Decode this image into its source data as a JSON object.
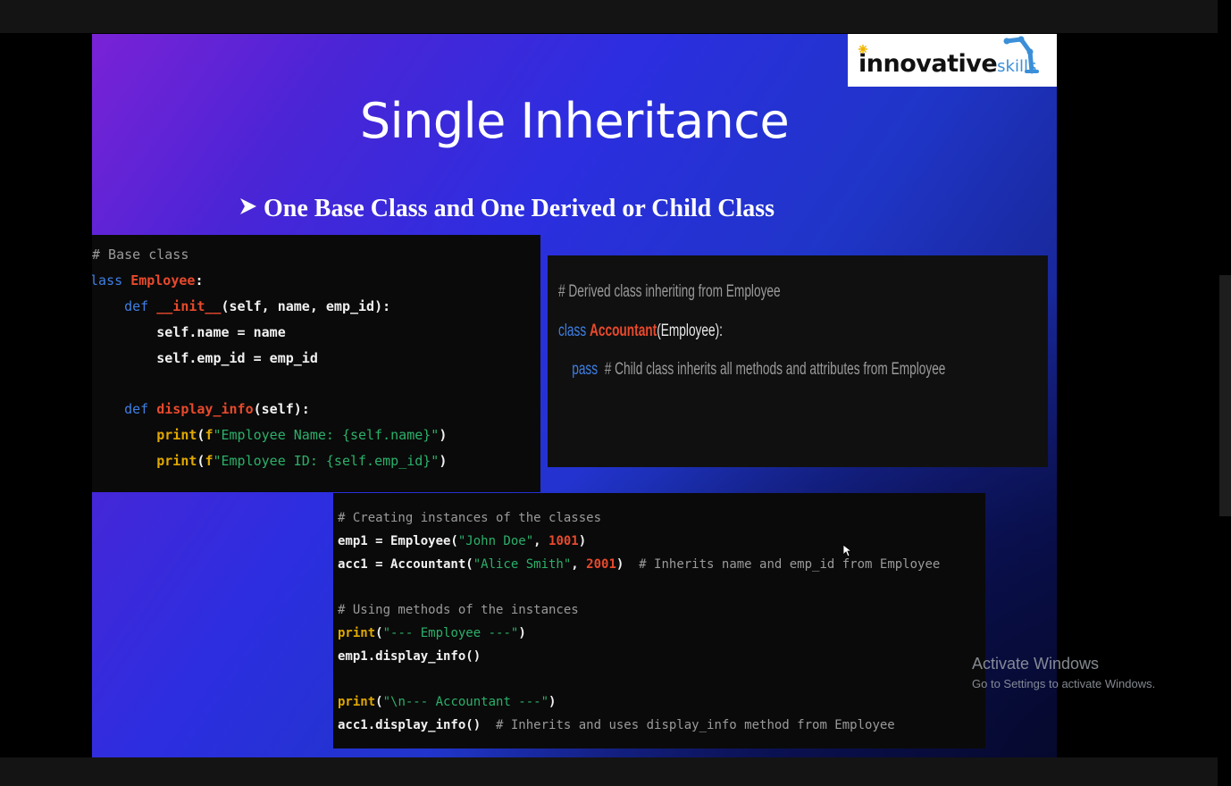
{
  "logo": {
    "brand": "innovative",
    "suffix": "skills"
  },
  "slide": {
    "title": "Single Inheritance",
    "bullet_icon": "arrow-bullet-icon",
    "subtitle": "One Base  Class and One Derived or Child Class"
  },
  "code": {
    "base": [
      "# Base class",
      "class Employee:",
      "    def __init__(self, name, emp_id):",
      "        self.name = name",
      "        self.emp_id = emp_id",
      "    def display_info(self):",
      "        print(f\"Employee Name: {self.name}\")",
      "        print(f\"Employee ID: {self.emp_id}\")"
    ],
    "derived": [
      "# Derived class inheriting from Employee",
      "class Accountant(Employee):",
      "    pass  # Child class inherits all methods and attributes from Employee"
    ],
    "usage": [
      "# Creating instances of the classes",
      "emp1 = Employee(\"John Doe\", 1001)",
      "acc1 = Accountant(\"Alice Smith\", 2001)  # Inherits name and emp_id from Employee",
      "# Using methods of the instances",
      "print(\"--- Employee ---\")",
      "emp1.display_info()",
      "print(\"\\n--- Accountant ---\")",
      "acc1.display_info()  # Inherits and uses display_info method from Employee"
    ]
  },
  "watermark": {
    "title": "Activate Windows",
    "subtitle": "Go to Settings to activate Windows."
  },
  "colors": {
    "keyword": "#3f7fe4",
    "class_name": "#e8492c",
    "print": "#e0a800",
    "string": "#2bb06a",
    "comment": "#9a9a9a"
  }
}
